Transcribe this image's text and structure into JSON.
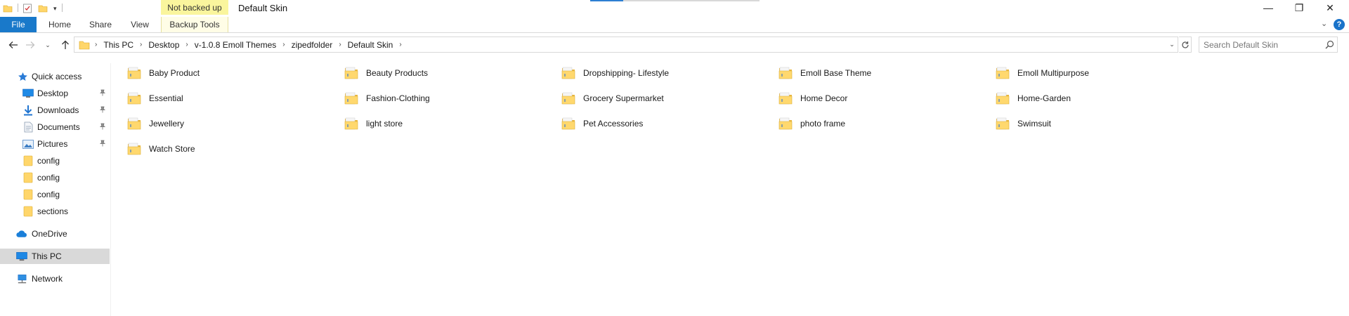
{
  "titlebar": {
    "context_tab_label": "Not backed up",
    "window_title": "Default Skin",
    "minimize_glyph": "—",
    "restore_glyph": "❐",
    "close_glyph": "✕"
  },
  "ribbon": {
    "tabs": [
      {
        "label": "File"
      },
      {
        "label": "Home"
      },
      {
        "label": "Share"
      },
      {
        "label": "View"
      },
      {
        "label": "Backup Tools"
      }
    ],
    "expand_glyph": "⌄",
    "help_glyph": "?"
  },
  "address": {
    "breadcrumbs": [
      "This PC",
      "Desktop",
      "v-1.0.8 Emoll Themes",
      "zipedfolder",
      "Default Skin"
    ]
  },
  "search": {
    "placeholder": "Search Default Skin",
    "value": ""
  },
  "navpane": {
    "items": [
      {
        "label": "Quick access",
        "icon": "star-icon"
      },
      {
        "label": "Desktop",
        "icon": "desktop-icon",
        "pinned": true
      },
      {
        "label": "Downloads",
        "icon": "downloads-icon",
        "pinned": true
      },
      {
        "label": "Documents",
        "icon": "documents-icon",
        "pinned": true
      },
      {
        "label": "Pictures",
        "icon": "pictures-icon",
        "pinned": true
      },
      {
        "label": "config",
        "icon": "folder-icon"
      },
      {
        "label": "config",
        "icon": "folder-icon"
      },
      {
        "label": "config",
        "icon": "folder-icon"
      },
      {
        "label": "sections",
        "icon": "folder-icon"
      },
      {
        "label": "OneDrive",
        "icon": "cloud-icon"
      },
      {
        "label": "This PC",
        "icon": "computer-icon",
        "selected": true
      },
      {
        "label": "Network",
        "icon": "network-icon"
      }
    ],
    "pin_glyph": "📌"
  },
  "content": {
    "folders": [
      "Baby Product",
      "Beauty Products",
      "Dropshipping- Lifestyle",
      "Emoll Base Theme",
      "Emoll Multipurpose",
      "Essential",
      "Fashion-Clothing",
      "Grocery Supermarket",
      "Home Decor",
      "Home-Garden",
      "Jewellery",
      "light store",
      "Pet Accessories",
      "photo frame",
      "Swimsuit",
      "Watch Store"
    ]
  },
  "colors": {
    "accent": "#1979ca",
    "context_tab": "#faf59d",
    "selected_nav": "#d9d9d9",
    "folder": "#ffd66b"
  }
}
